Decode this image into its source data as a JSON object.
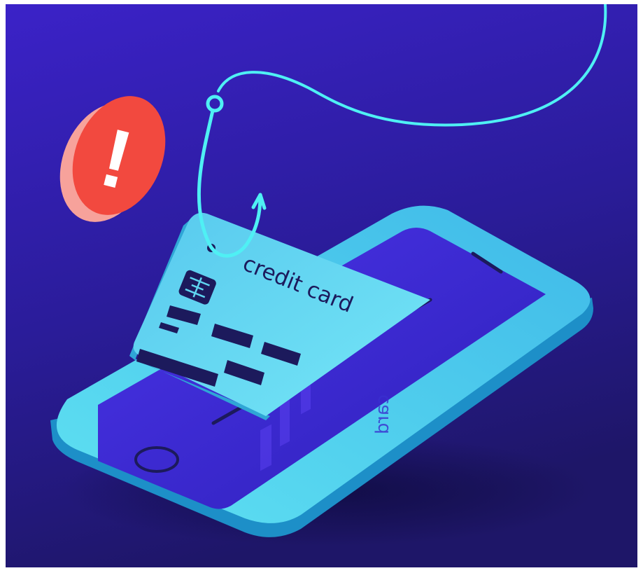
{
  "illustration": {
    "card_label": "credit card",
    "reflection_label": "card",
    "alert_symbol": "!"
  },
  "colors": {
    "background_top": "#3b22c8",
    "background_bottom": "#1e1668",
    "phone_body": "#4fd3ee",
    "phone_edge": "#1d8fc8",
    "phone_screen": "#3a2ad6",
    "card_face": "#5fd5f0",
    "card_shadow": "#2fa6d6",
    "hook_line": "#4ff0f4",
    "alert_red": "#f2493f",
    "alert_side": "#f7a29b",
    "dark_ink": "#1c1a5c"
  },
  "icons": {
    "alert": "exclamation-alert-icon",
    "hook": "fish-hook-icon",
    "phone": "smartphone-icon",
    "card": "credit-card-icon",
    "home_button": "home-button-icon",
    "chip": "card-chip-icon"
  }
}
